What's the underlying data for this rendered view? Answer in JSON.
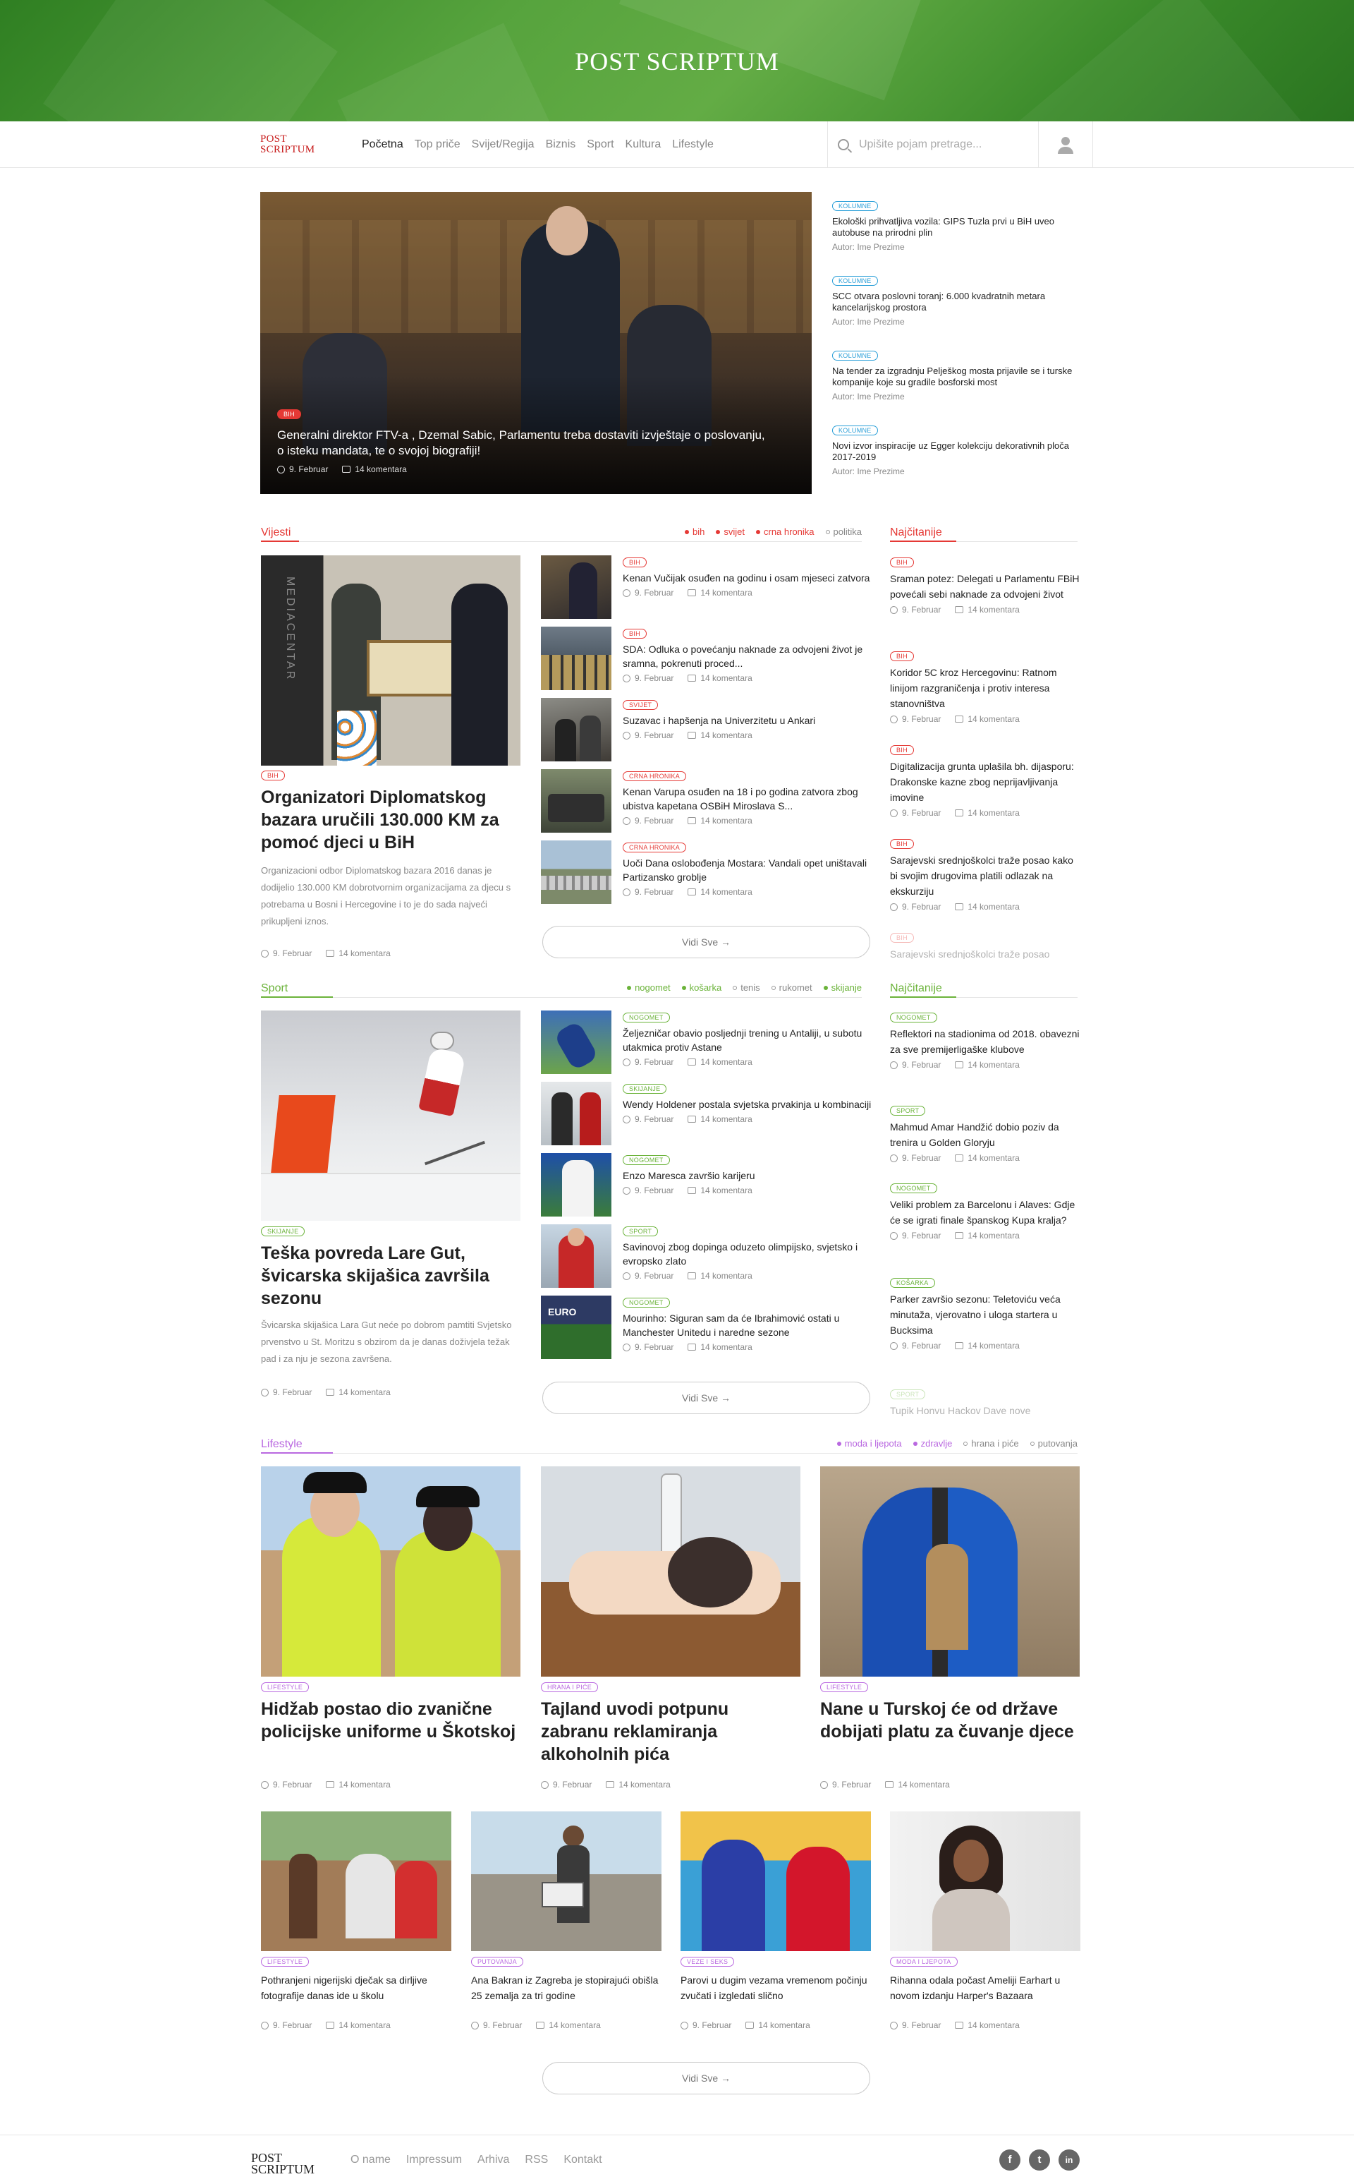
{
  "banner": {
    "title": "POST SCRIPTUM"
  },
  "nav": {
    "logo_line1": "POST",
    "logo_line2": "SCRIPTUM",
    "items": [
      "Početna",
      "Top priče",
      "Svijet/Regija",
      "Biznis",
      "Sport",
      "Kultura",
      "Lifestyle"
    ],
    "search_placeholder": "Upišite pojam pretrage..."
  },
  "hero": {
    "tag": "BIH",
    "title": "Generalni direktor FTV-a , Dzemal Sabic, Parlamentu treba dostaviti izvještaje o poslovanju, o isteku mandata, te o svojoj biografiji!",
    "date": "9. Februar",
    "comments": "14 komentara"
  },
  "kolumne": [
    {
      "tag": "KOLUMNE",
      "title": "Ekološki prihvatljiva vozila: GIPS Tuzla prvi u BiH uveo autobuse na prirodni plin",
      "author": "Autor: Ime Prezime"
    },
    {
      "tag": "KOLUMNE",
      "title": "SCC otvara poslovni toranj: 6.000 kvadratnih metara kancelarijskog prostora",
      "author": "Autor: Ime Prezime"
    },
    {
      "tag": "KOLUMNE",
      "title": "Na tender za izgradnju Pelješkog mosta prijavile se i turske kompanije koje su gradile bosforski most",
      "author": "Autor: Ime Prezime"
    },
    {
      "tag": "KOLUMNE",
      "title": "Novi izvor inspiracije uz Egger kolekciju dekorativnih ploča 2017-2019",
      "author": "Autor: Ime Prezime"
    }
  ],
  "vijesti": {
    "name": "Vijesti",
    "filters": [
      "bih",
      "svijet",
      "crna hronika",
      "politika"
    ],
    "lead": {
      "tag": "BIH",
      "title": "Organizatori Diplomatskog bazara uručili 130.000 KM za pomoć djeci u BiH",
      "excerpt": "Organizacioni odbor Diplomatskog bazara 2016 danas je dodijelio 130.000 KM dobrotvornim organizacijama za djecu s potrebama u Bosni i Hercegovine i to je do sada najveći prikupljeni iznos.",
      "date": "9. Februar",
      "comments": "14 komentara"
    },
    "list": [
      {
        "tag": "BIH",
        "title": "Kenan Vučijak osuđen na godinu i osam mjeseci zatvora",
        "date": "9. Februar",
        "comments": "14 komentara"
      },
      {
        "tag": "BIH",
        "title": "SDA: Odluka o povećanju naknade za odvojeni život je sramna, pokrenuti proced...",
        "date": "9. Februar",
        "comments": "14 komentara"
      },
      {
        "tag": "SVIJET",
        "title": "Suzavac i hapšenja na Univerzitetu u Ankari",
        "date": "9. Februar",
        "comments": "14 komentara"
      },
      {
        "tag": "CRNA HRONIKA",
        "title": "Kenan Varupa osuđen na 18 i po godina zatvora zbog ubistva kapetana OSBiH Miroslava S...",
        "date": "9. Februar",
        "comments": "14 komentara"
      },
      {
        "tag": "CRNA HRONIKA",
        "title": "Uoči Dana oslobođenja Mostara: Vandali opet uništavali Partizansko groblje",
        "date": "9. Februar",
        "comments": "14 komentara"
      }
    ],
    "more": "Vidi Sve →",
    "popular_name": "Najčitanije",
    "popular": [
      {
        "tag": "BIH",
        "title": "Sraman potez: Delegati u Parlamentu FBiH povećali sebi naknade za odvojeni život",
        "date": "9. Februar",
        "comments": "14 komentara"
      },
      {
        "tag": "BIH",
        "title": "Koridor 5C kroz Hercegovinu: Ratnom linijom razgraničenja i protiv interesa stanovništva",
        "date": "9. Februar",
        "comments": "14 komentara"
      },
      {
        "tag": "BIH",
        "title": "Digitalizacija grunta uplašila bh. dijasporu: Drakonske kazne zbog neprijavljivanja imovine",
        "date": "9. Februar",
        "comments": "14 komentara"
      },
      {
        "tag": "BIH",
        "title": "Sarajevski srednjoškolci traže posao kako bi svojim drugovima platili odlazak na ekskurziju",
        "date": "9. Februar",
        "comments": "14 komentara"
      },
      {
        "tag": "BIH",
        "title": "Sarajevski srednjoškolci traže posao",
        "date": "",
        "comments": ""
      }
    ]
  },
  "sport": {
    "name": "Sport",
    "filters": [
      "nogomet",
      "košarka",
      "tenis",
      "rukomet",
      "skijanje"
    ],
    "lead": {
      "tag": "SKIJANJE",
      "title": "Teška povreda Lare Gut, švicarska skijašica završila sezonu",
      "excerpt": "Švicarska skijašica Lara Gut neće po dobrom pamtiti Svjetsko prvenstvo u St. Moritzu s obzirom da je danas doživjela težak pad i za nju je sezona završena.",
      "date": "9. Februar",
      "comments": "14 komentara"
    },
    "list": [
      {
        "tag": "NOGOMET",
        "title": "Željezničar obavio posljednji trening u Antaliji, u subotu utakmica protiv Astane",
        "date": "9. Februar",
        "comments": "14 komentara"
      },
      {
        "tag": "SKIJANJE",
        "title": "Wendy Holdener postala svjetska prvakinja u kombinaciji",
        "date": "9. Februar",
        "comments": "14 komentara"
      },
      {
        "tag": "NOGOMET",
        "title": "Enzo Maresca završio karijeru",
        "date": "9. Februar",
        "comments": "14 komentara"
      },
      {
        "tag": "SPORT",
        "title": "Savinovoj zbog dopinga oduzeto olimpijsko, svjetsko i evropsko zlato",
        "date": "9. Februar",
        "comments": "14 komentara"
      },
      {
        "tag": "NOGOMET",
        "title": "Mourinho: Siguran sam da će Ibrahimović ostati u Manchester Unitedu i naredne sezone",
        "date": "9. Februar",
        "comments": "14 komentara"
      }
    ],
    "more": "Vidi Sve →",
    "popular_name": "Najčitanije",
    "popular": [
      {
        "tag": "NOGOMET",
        "title": "Reflektori na stadionima od 2018. obavezni za sve premijerligaške klubove",
        "date": "9. Februar",
        "comments": "14 komentara"
      },
      {
        "tag": "SPORT",
        "title": "Mahmud Amar Handžić dobio poziv da trenira u Golden Gloryju",
        "date": "9. Februar",
        "comments": "14 komentara"
      },
      {
        "tag": "NOGOMET",
        "title": "Veliki problem za Barcelonu i Alaves: Gdje će se igrati finale španskog Kupa kralja?",
        "date": "9. Februar",
        "comments": "14 komentara"
      },
      {
        "tag": "KOŠARKA",
        "title": "Parker završio sezonu: Teletoviću veća minutaža, vjerovatno i uloga startera u Bucksima",
        "date": "9. Februar",
        "comments": "14 komentara"
      },
      {
        "tag": "SPORT",
        "title": "Tupik Honvu Hackov Dave nove",
        "date": "",
        "comments": ""
      }
    ]
  },
  "lifestyle": {
    "name": "Lifestyle",
    "filters": [
      "moda i ljepota",
      "zdravlje",
      "hrana i piće",
      "putovanja"
    ],
    "big": [
      {
        "tag": "LIFESTYLE",
        "title": "Hidžab postao dio zvanične policijske uniforme u Škotskoj",
        "date": "9. Februar",
        "comments": "14 komentara"
      },
      {
        "tag": "HRANA I PIĆE",
        "title": "Tajland uvodi potpunu zabranu reklamiranja alkoholnih pića",
        "date": "9. Februar",
        "comments": "14 komentara"
      },
      {
        "tag": "LIFESTYLE",
        "title": "Nane u Turskoj će od države dobijati platu za čuvanje djece",
        "date": "9. Februar",
        "comments": "14 komentara"
      }
    ],
    "small": [
      {
        "tag": "LIFESTYLE",
        "title": "Pothranjeni nigerijski dječak sa dirljive fotografije danas ide u školu",
        "date": "9. Februar",
        "comments": "14 komentara"
      },
      {
        "tag": "PUTOVANJA",
        "title": "Ana Bakran iz Zagreba je stopirajući obišla 25 zemalja za tri godine",
        "date": "9. Februar",
        "comments": "14 komentara"
      },
      {
        "tag": "VEZE I SEKS",
        "title": "Parovi u dugim vezama vremenom počinju zvučati i izgledati slično",
        "date": "9. Februar",
        "comments": "14 komentara"
      },
      {
        "tag": "MODA I LJEPOTA",
        "title": "Rihanna odala počast Ameliji Earhart u novom izdanju Harper's Bazaara",
        "date": "9. Februar",
        "comments": "14 komentara"
      }
    ],
    "more": "Vidi Sve →"
  },
  "footer": {
    "logo_line1": "POST",
    "logo_line2": "SCRIPTUM",
    "links": [
      "O name",
      "Impressum",
      "Arhiva",
      "RSS",
      "Kontakt"
    ],
    "social": [
      "f",
      "t",
      "in"
    ]
  },
  "colors": {
    "vijesti": "#e53935",
    "sport": "#6bb33a",
    "lifestyle": "#b968e0",
    "kolumne": "#2a9fd8",
    "banner": "#4c9a36"
  }
}
